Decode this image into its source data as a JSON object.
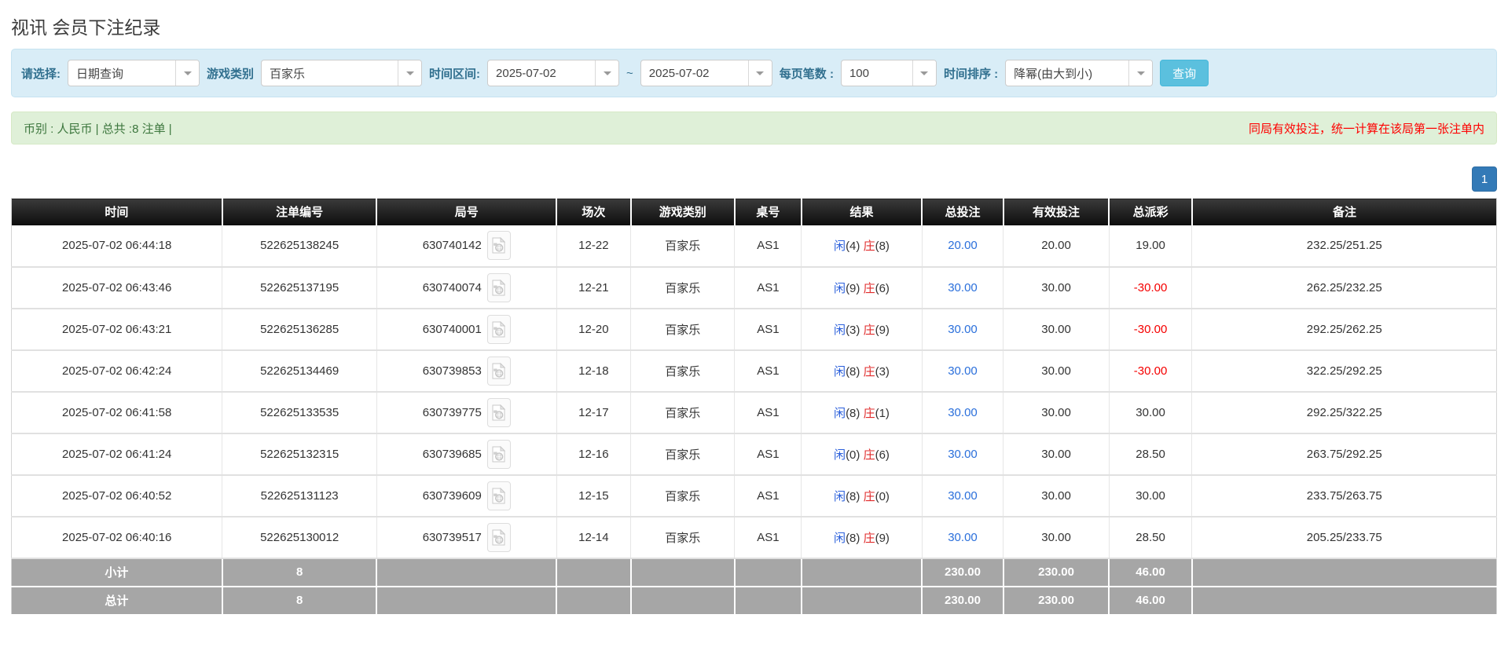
{
  "page": {
    "title": "视讯 会员下注纪录"
  },
  "filter": {
    "select_label": "请选择:",
    "select_value": "日期查询",
    "game_label": "游戏类别",
    "game_value": "百家乐",
    "range_label": "时间区间:",
    "date_from": "2025-07-02",
    "range_separator": "~",
    "date_to": "2025-07-02",
    "page_size_label": "每页笔数 :",
    "page_size_value": "100",
    "sort_label": "时间排序 :",
    "sort_value": "降幂(由大到小)",
    "search_button": "查询"
  },
  "summary_bar": {
    "left_text": "币别 : 人民币 | 总共 :8 注单 |",
    "right_text": "同局有效投注，统一计算在该局第一张注单内"
  },
  "pagination": {
    "pages": [
      "1"
    ]
  },
  "table": {
    "headers": [
      "时间",
      "注单编号",
      "局号",
      "场次",
      "游戏类别",
      "桌号",
      "结果",
      "总投注",
      "有效投注",
      "总派彩",
      "备注"
    ],
    "rows": [
      {
        "time": "2025-07-02 06:44:18",
        "bet_id": "522625138245",
        "round_id": "630740142",
        "session": "12-22",
        "game": "百家乐",
        "table_id": "AS1",
        "result": {
          "player": "闲",
          "player_score": "(4)",
          "banker": "庄",
          "banker_score": "(8)"
        },
        "total_bet": "20.00",
        "valid_bet": "20.00",
        "payout": "19.00",
        "remark": "232.25/251.25"
      },
      {
        "time": "2025-07-02 06:43:46",
        "bet_id": "522625137195",
        "round_id": "630740074",
        "session": "12-21",
        "game": "百家乐",
        "table_id": "AS1",
        "result": {
          "player": "闲",
          "player_score": "(9)",
          "banker": "庄",
          "banker_score": "(6)"
        },
        "total_bet": "30.00",
        "valid_bet": "30.00",
        "payout": "-30.00",
        "remark": "262.25/232.25"
      },
      {
        "time": "2025-07-02 06:43:21",
        "bet_id": "522625136285",
        "round_id": "630740001",
        "session": "12-20",
        "game": "百家乐",
        "table_id": "AS1",
        "result": {
          "player": "闲",
          "player_score": "(3)",
          "banker": "庄",
          "banker_score": "(9)"
        },
        "total_bet": "30.00",
        "valid_bet": "30.00",
        "payout": "-30.00",
        "remark": "292.25/262.25"
      },
      {
        "time": "2025-07-02 06:42:24",
        "bet_id": "522625134469",
        "round_id": "630739853",
        "session": "12-18",
        "game": "百家乐",
        "table_id": "AS1",
        "result": {
          "player": "闲",
          "player_score": "(8)",
          "banker": "庄",
          "banker_score": "(3)"
        },
        "total_bet": "30.00",
        "valid_bet": "30.00",
        "payout": "-30.00",
        "remark": "322.25/292.25"
      },
      {
        "time": "2025-07-02 06:41:58",
        "bet_id": "522625133535",
        "round_id": "630739775",
        "session": "12-17",
        "game": "百家乐",
        "table_id": "AS1",
        "result": {
          "player": "闲",
          "player_score": "(8)",
          "banker": "庄",
          "banker_score": "(1)"
        },
        "total_bet": "30.00",
        "valid_bet": "30.00",
        "payout": "30.00",
        "remark": "292.25/322.25"
      },
      {
        "time": "2025-07-02 06:41:24",
        "bet_id": "522625132315",
        "round_id": "630739685",
        "session": "12-16",
        "game": "百家乐",
        "table_id": "AS1",
        "result": {
          "player": "闲",
          "player_score": "(0)",
          "banker": "庄",
          "banker_score": "(6)"
        },
        "total_bet": "30.00",
        "valid_bet": "30.00",
        "payout": "28.50",
        "remark": "263.75/292.25"
      },
      {
        "time": "2025-07-02 06:40:52",
        "bet_id": "522625131123",
        "round_id": "630739609",
        "session": "12-15",
        "game": "百家乐",
        "table_id": "AS1",
        "result": {
          "player": "闲",
          "player_score": "(8)",
          "banker": "庄",
          "banker_score": "(0)"
        },
        "total_bet": "30.00",
        "valid_bet": "30.00",
        "payout": "30.00",
        "remark": "233.75/263.75"
      },
      {
        "time": "2025-07-02 06:40:16",
        "bet_id": "522625130012",
        "round_id": "630739517",
        "session": "12-14",
        "game": "百家乐",
        "table_id": "AS1",
        "result": {
          "player": "闲",
          "player_score": "(8)",
          "banker": "庄",
          "banker_score": "(9)"
        },
        "total_bet": "30.00",
        "valid_bet": "30.00",
        "payout": "28.50",
        "remark": "205.25/233.75"
      }
    ],
    "footer_rows": [
      {
        "label": "小计",
        "count": "8",
        "total_bet": "230.00",
        "valid_bet": "230.00",
        "payout": "46.00"
      },
      {
        "label": "总计",
        "count": "8",
        "total_bet": "230.00",
        "valid_bet": "230.00",
        "payout": "46.00"
      }
    ]
  },
  "colors": {
    "link_blue": "#2a6fdb",
    "player_blue": "#2a5fdb",
    "banker_red": "#e02b2b",
    "negative_red": "#f50000",
    "panel_blue": "#d9edf7",
    "alert_green": "#dff0d8",
    "header_black": "#1a1a1a",
    "footer_gray": "#a6a6a6",
    "button_info": "#5bc0de",
    "pager_blue": "#337ab7"
  }
}
